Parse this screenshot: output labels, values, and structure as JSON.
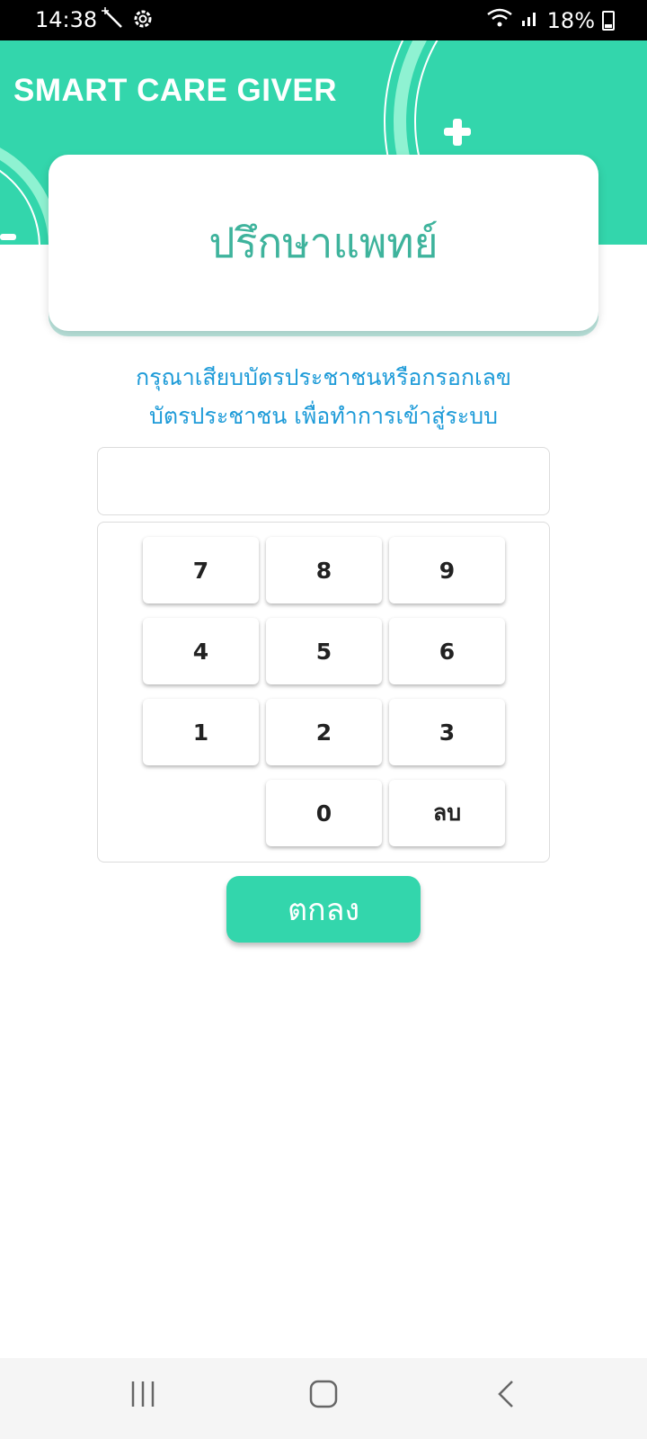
{
  "status_bar": {
    "time": "14:38",
    "battery": "18%",
    "left_icons": [
      "magic-wand-icon",
      "gear-icon"
    ],
    "right_icons": [
      "wifi-icon",
      "signal-icon",
      "battery-charging-icon"
    ]
  },
  "header": {
    "brand": "SMART CARE GIVER",
    "background_color": "#33d6ac"
  },
  "title_card": {
    "title": "ปรึกษาแพทย์",
    "title_color": "#3eb39c"
  },
  "instruction": {
    "line1": "กรุณาเสียบบัตรประชาชนหรือกรอกเลข",
    "line2": "บัตรประชาชน เพื่อทำการเข้าสู่ระบบ",
    "color": "#1e9bd8"
  },
  "id_input": {
    "value": "",
    "placeholder": ""
  },
  "keypad": {
    "keys": [
      "7",
      "8",
      "9",
      "4",
      "5",
      "6",
      "1",
      "2",
      "3",
      "0",
      "ลบ"
    ]
  },
  "actions": {
    "ok_label": "ตกลง"
  },
  "nav_bar": {
    "icons": [
      "recent-apps-icon",
      "home-icon",
      "back-icon"
    ]
  }
}
